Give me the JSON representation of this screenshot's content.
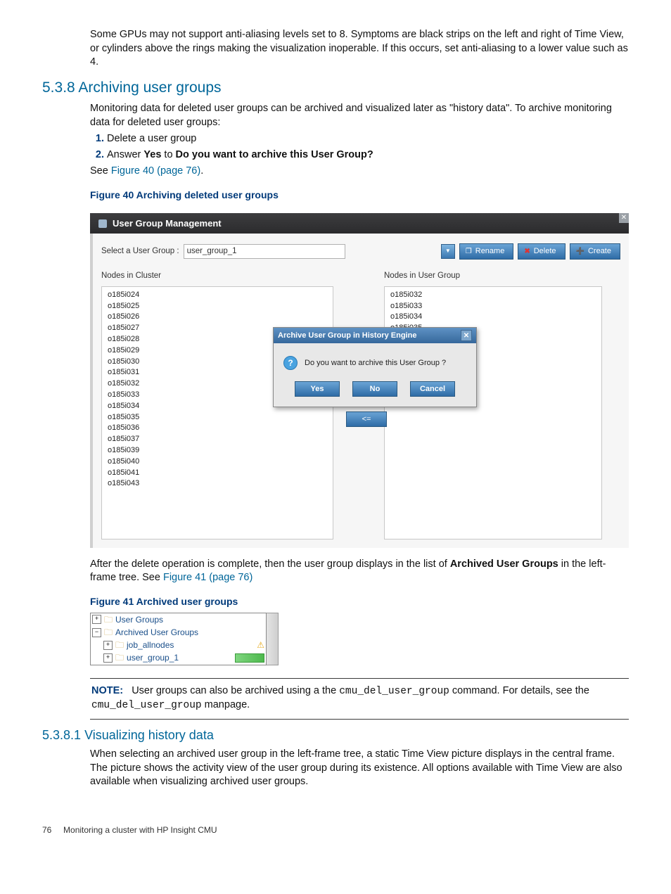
{
  "intro": "Some GPUs may not support anti-aliasing levels set to 8. Symptoms are black strips on the left and right of Time View, or cylinders above the rings making the visualization inoperable. If this occurs, set anti-aliasing to a lower value such as 4.",
  "section": {
    "number": "5.3.8",
    "title": "Archiving user groups",
    "para1": "Monitoring data for deleted user groups can be archived and visualized later as \"history data\". To archive monitoring data for deleted user groups:",
    "step1": "Delete a user group",
    "step2_pre": "Answer ",
    "step2_yes": "Yes",
    "step2_mid": " to ",
    "step2_q": "Do you want to archive this User Group?",
    "see_pre": "See ",
    "see_link": "Figure 40 (page 76)",
    "see_post": "."
  },
  "fig40": {
    "caption": "Figure 40 Archiving deleted user groups",
    "panel_title": "User Group Management",
    "select_label": "Select a User Group :",
    "select_value": "user_group_1",
    "buttons": {
      "rename": "Rename",
      "delete": "Delete",
      "create": "Create"
    },
    "left_header": "Nodes in Cluster",
    "right_header": "Nodes in User Group",
    "cluster_nodes": [
      "o185i024",
      "o185i025",
      "o185i026",
      "o185i027",
      "o185i028",
      "o185i029",
      "o185i030",
      "o185i031",
      "o185i032",
      "o185i033",
      "o185i034",
      "o185i035",
      "o185i036",
      "o185i037",
      "o185i039",
      "o185i040",
      "o185i041",
      "o185i043"
    ],
    "group_nodes": [
      "o185i032",
      "o185i033",
      "o185i034",
      "o185i035"
    ],
    "arrow_label": "<=",
    "modal": {
      "title": "Archive User Group in History Engine",
      "question": "Do you want to archive this User Group ?",
      "yes": "Yes",
      "no": "No",
      "cancel": "Cancel"
    }
  },
  "after_fig40_pre": "After the delete operation is complete, then the user group displays in the list of ",
  "after_fig40_bold": "Archived User Groups",
  "after_fig40_mid": " in the left-frame tree. See ",
  "after_fig40_link": "Figure 41 (page 76)",
  "fig41": {
    "caption": "Figure 41 Archived user groups",
    "rows": {
      "r0": "User Groups",
      "r1": "Archived User Groups",
      "r2": "job_allnodes",
      "r3": "user_group_1"
    }
  },
  "note": {
    "label": "NOTE:",
    "t1": "User groups can also be archived using a the ",
    "cmd1": "cmu_del_user_group",
    "t2": " command. For details, see the ",
    "cmd2": "cmu_del_user_group",
    "t3": " manpage."
  },
  "subsection": {
    "number": "5.3.8.1",
    "title": "Visualizing history data",
    "para": "When selecting an archived user group in the left-frame tree, a static Time View picture displays in the central frame. The picture shows the activity view of the user group during its existence. All options available with Time View are also available when visualizing archived user groups."
  },
  "footer": {
    "page": "76",
    "title": "Monitoring a cluster with HP Insight CMU"
  }
}
